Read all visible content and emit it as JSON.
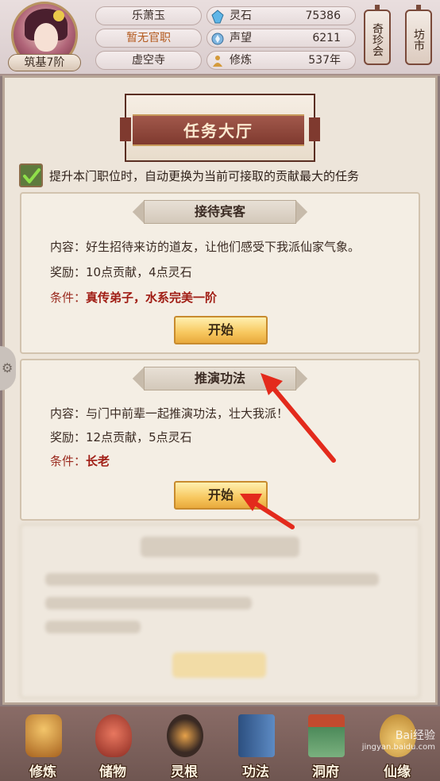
{
  "player": {
    "name": "乐萧玉",
    "official_rank": "暂无官职",
    "sect": "虚空寺",
    "realm": "筑基7阶"
  },
  "stats": [
    {
      "icon": "spirit-stone-icon",
      "label": "灵石",
      "value": "75386"
    },
    {
      "icon": "reputation-icon",
      "label": "声望",
      "value": "6211"
    },
    {
      "icon": "cultivation-icon",
      "label": "修炼",
      "value": "537年"
    }
  ],
  "shops": [
    {
      "label": "奇珍会"
    },
    {
      "label": "坊市"
    }
  ],
  "page": {
    "title": "任务大厅",
    "auto_option": "提升本门职位时，自动更换为当前可接取的贡献最大的任务",
    "auto_checked": true
  },
  "tasks": [
    {
      "name": "接待宾客",
      "content_label": "内容：",
      "content": "好生招待来访的道友，让他们感受下我派仙家气象。",
      "reward_label": "奖励：",
      "reward": "10点贡献，4点灵石",
      "condition_label": "条件：",
      "condition": "真传弟子，水系完美一阶",
      "button": "开始"
    },
    {
      "name": "推演功法",
      "content_label": "内容：",
      "content": "与门中前辈一起推演功法，壮大我派！",
      "reward_label": "奖励：",
      "reward": "12点贡献，5点灵石",
      "condition_label": "条件：",
      "condition": "长老",
      "button": "开始"
    }
  ],
  "nav": [
    {
      "label": "修炼",
      "icon": "monk-icon",
      "color": "#d49a3a"
    },
    {
      "label": "储物",
      "icon": "bag-icon",
      "color": "#c0473a"
    },
    {
      "label": "灵根",
      "icon": "spirit-root-icon",
      "color": "#3a2a24"
    },
    {
      "label": "功法",
      "icon": "book-icon",
      "color": "#3d6ea8"
    },
    {
      "label": "洞府",
      "icon": "cave-house-icon",
      "color": "#4c8a5a"
    },
    {
      "label": "仙缘",
      "icon": "gourd-icon",
      "color": "#e0b04a"
    }
  ],
  "watermark": {
    "brand": "Bai经验",
    "url": "jingyan.baidu.com"
  },
  "colors": {
    "accent_red": "#a01d14",
    "button_gold": "#f7c75e",
    "banner_red": "#7f3a2f"
  }
}
